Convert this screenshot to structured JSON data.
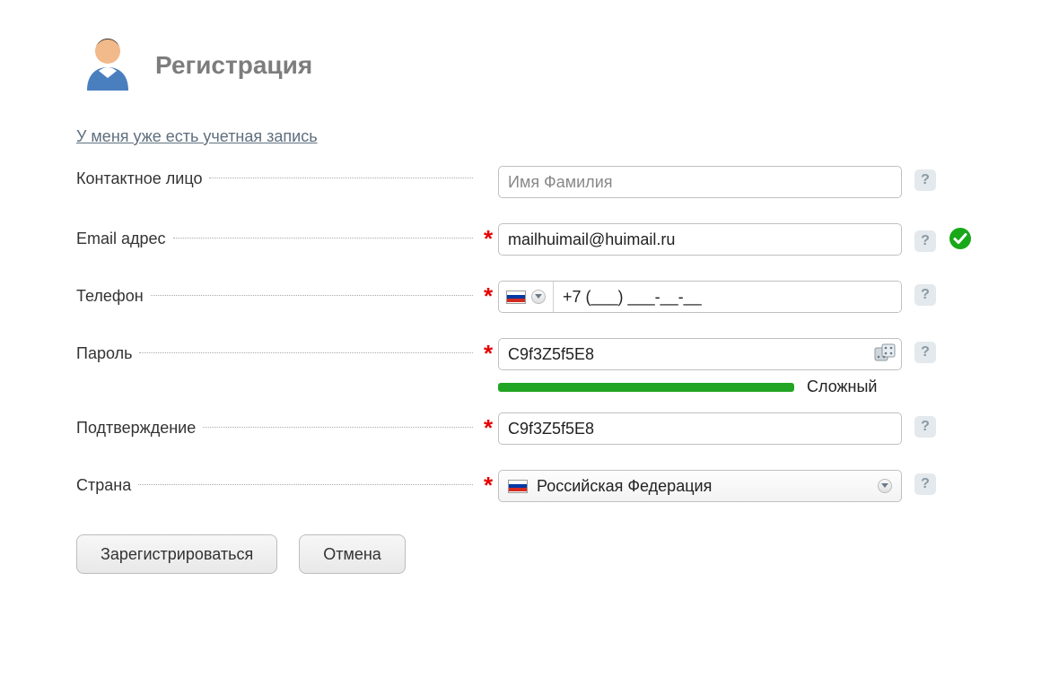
{
  "title": "Регистрация",
  "existing_account_link": "У меня уже есть учетная запись",
  "fields": {
    "contact": {
      "label": "Контактное лицо",
      "placeholder": "Имя Фамилия",
      "value": "",
      "required": false
    },
    "email": {
      "label": "Email адрес",
      "value": "mailhuimail@huimail.ru",
      "required": true,
      "valid": true
    },
    "phone": {
      "label": "Телефон",
      "country_code": "RU",
      "mask": "+7 (___) ___-__-__",
      "value": "",
      "required": true
    },
    "password": {
      "label": "Пароль",
      "value": "C9f3Z5f5E8",
      "required": true,
      "strength_label": "Сложный",
      "strength_color": "#22a522",
      "strength_ratio": 0.74
    },
    "confirm": {
      "label": "Подтверждение",
      "value": "C9f3Z5f5E8",
      "required": true
    },
    "country": {
      "label": "Страна",
      "selected": "Российская Федерация",
      "required": true
    }
  },
  "help_tooltip_glyph": "?",
  "buttons": {
    "register": "Зарегистрироваться",
    "cancel": "Отмена"
  }
}
